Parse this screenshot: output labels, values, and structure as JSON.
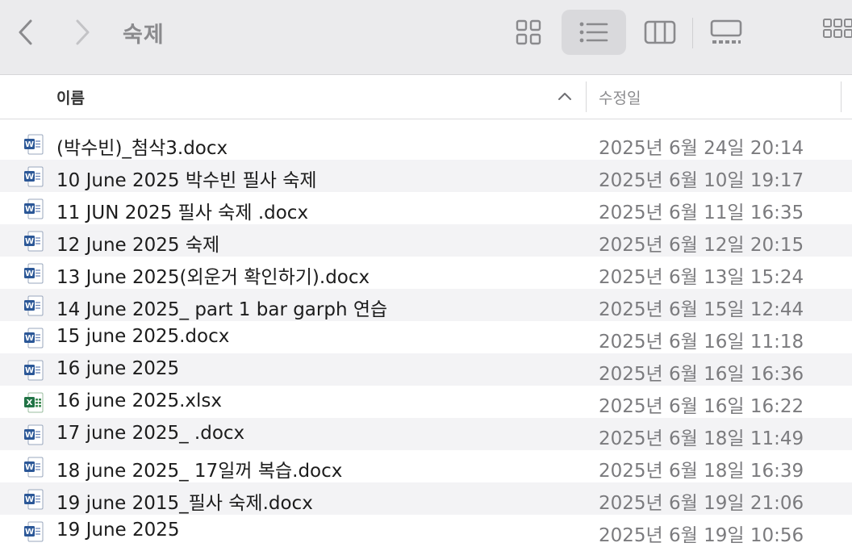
{
  "window": {
    "title": "숙제"
  },
  "toolbar": {
    "back_icon": "chevron-left-icon",
    "forward_icon": "chevron-right-icon",
    "views": [
      "icon-view-icon",
      "list-view-icon",
      "column-view-icon",
      "gallery-view-icon"
    ],
    "active_view": "list"
  },
  "columns": {
    "name": "이름",
    "date_modified": "수정일",
    "sort": "ascending"
  },
  "files": [
    {
      "name": "(박수빈)_첨삭3.docx",
      "date": "2025년 6월 24일 20:14",
      "icon": "word-doc-icon"
    },
    {
      "name": "10 June 2025 박수빈 필사 숙제",
      "date": "2025년 6월 10일 19:17",
      "icon": "word-doc-icon"
    },
    {
      "name": "11 JUN 2025 필사 숙제 .docx",
      "date": "2025년 6월 11일 16:35",
      "icon": "word-doc-icon"
    },
    {
      "name": "12 June 2025 숙제",
      "date": "2025년 6월 12일 20:15",
      "icon": "word-doc-icon"
    },
    {
      "name": "13 June 2025(외운거 확인하기).docx",
      "date": "2025년 6월 13일 15:24",
      "icon": "word-doc-icon"
    },
    {
      "name": "14 June 2025_ part 1 bar garph 연습",
      "date": "2025년 6월 15일 12:44",
      "icon": "word-doc-icon"
    },
    {
      "name": "15 june 2025.docx",
      "date": "2025년 6월 16일 11:18",
      "icon": "word-doc-icon"
    },
    {
      "name": "16 june 2025",
      "date": "2025년 6월 16일 16:36",
      "icon": "word-doc-icon"
    },
    {
      "name": "16 june 2025.xlsx",
      "date": "2025년 6월 16일 16:22",
      "icon": "excel-sheet-icon"
    },
    {
      "name": "17 june 2025_ .docx",
      "date": "2025년 6월 18일 11:49",
      "icon": "word-doc-icon"
    },
    {
      "name": "18 june 2025_ 17일꺼 복습.docx",
      "date": "2025년 6월 18일 16:39",
      "icon": "word-doc-icon"
    },
    {
      "name": "19 june 2015_필사 숙제.docx",
      "date": "2025년 6월 19일 21:06",
      "icon": "word-doc-icon"
    },
    {
      "name": "19 June 2025",
      "date": "2025년 6월 19일 10:56",
      "icon": "word-doc-icon"
    }
  ],
  "colors": {
    "word": "#2b5797",
    "excel": "#217346",
    "toolbar_bg": "#ebebed",
    "alt_row": "#f3f3f5"
  }
}
